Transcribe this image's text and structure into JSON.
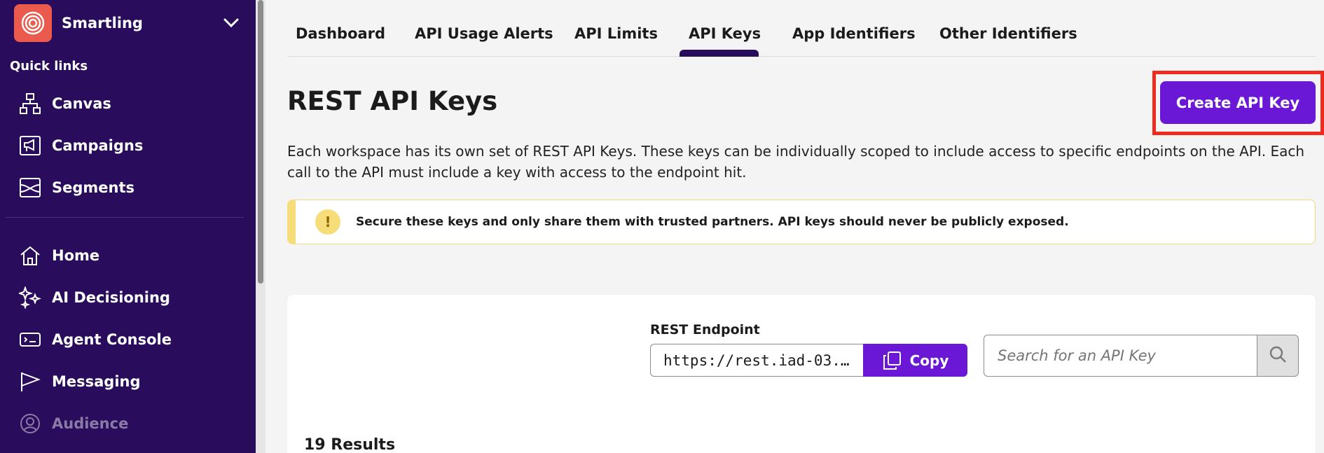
{
  "sidebar": {
    "workspace_name": "Smartling",
    "quick_links_label": "Quick links",
    "quick_links": [
      {
        "label": "Canvas",
        "icon": "canvas-icon"
      },
      {
        "label": "Campaigns",
        "icon": "campaigns-icon"
      },
      {
        "label": "Segments",
        "icon": "segments-icon"
      }
    ],
    "nav": [
      {
        "label": "Home",
        "icon": "home-icon"
      },
      {
        "label": "AI Decisioning",
        "icon": "sparkle-icon"
      },
      {
        "label": "Agent Console",
        "icon": "console-icon"
      },
      {
        "label": "Messaging",
        "icon": "messaging-icon"
      },
      {
        "label": "Audience",
        "icon": "audience-icon"
      }
    ]
  },
  "tabs": [
    {
      "label": "Dashboard"
    },
    {
      "label": "API Usage Alerts"
    },
    {
      "label": "API Limits"
    },
    {
      "label": "API Keys",
      "active": true
    },
    {
      "label": "App Identifiers"
    },
    {
      "label": "Other Identifiers"
    }
  ],
  "page": {
    "title": "REST API Keys",
    "create_button": "Create API Key",
    "description": "Each workspace has its own set of REST API Keys. These keys can be individually scoped to include access to specific endpoints on the API. Each call to the API must include a key with access to the endpoint hit.",
    "alert_icon": "!",
    "alert_text": "Secure these keys and only share them with trusted partners. API keys should never be publicly exposed."
  },
  "card": {
    "endpoint_label": "REST Endpoint",
    "endpoint_value": "https://rest.iad-03.…",
    "copy_label": "Copy",
    "search_placeholder": "Search for an API Key",
    "results_label": "19 Results"
  },
  "colors": {
    "sidebar_bg": "#2a0c5c",
    "accent": "#6a18d6",
    "highlight_border": "#f02a1d",
    "alert": "#f7dd79",
    "logo": "#ea5a4d"
  }
}
